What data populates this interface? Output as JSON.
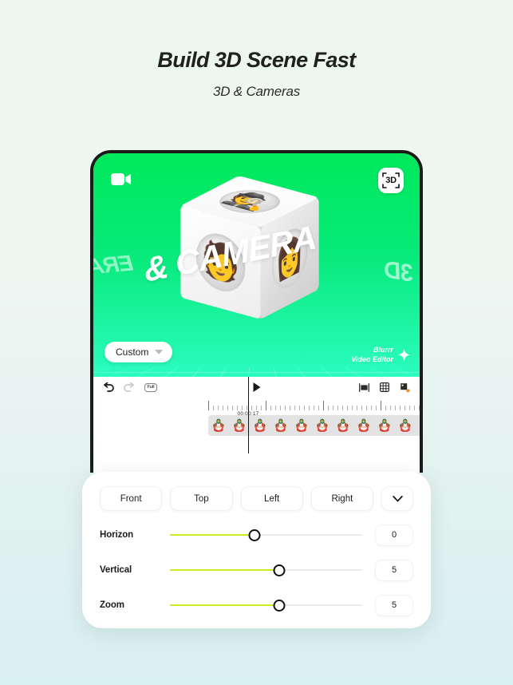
{
  "header": {
    "title": "Build 3D Scene Fast",
    "subtitle": "3D & Cameras"
  },
  "canvas": {
    "camera_icon": "video-camera-icon",
    "badge_3d": "3D",
    "ring_text_front": "& CAMERA",
    "ring_text_back": "3D",
    "ring_text_back2": "ERA",
    "preset_label": "Custom",
    "preset_caret": "chevron-down-icon",
    "watermark_line1": "Blurrr",
    "watermark_line2": "Video Editor",
    "watermark_icon": "sparkle-icon",
    "background_top_color": "#00e85a",
    "background_bottom_color": "#2bfcc0"
  },
  "editor": {
    "undo_icon": "undo-icon",
    "redo_icon": "redo-icon",
    "quality_badge": "Full",
    "play_icon": "play-icon",
    "fit_icon": "fit-screen-icon",
    "grid_icon": "grid-icon",
    "export_icon": "export-layers-icon",
    "timestamp": "00:00:17",
    "frame_thumbnail": "🪆"
  },
  "panel": {
    "views": [
      "Front",
      "Top",
      "Left",
      "Right"
    ],
    "collapse_icon": "chevron-down-icon",
    "sliders": [
      {
        "label": "Horizon",
        "value": "0",
        "fill_percent": 44
      },
      {
        "label": "Vertical",
        "value": "5",
        "fill_percent": 57
      },
      {
        "label": "Zoom",
        "value": "5",
        "fill_percent": 57
      }
    ],
    "slider_fill_color": "#cfe91f"
  }
}
